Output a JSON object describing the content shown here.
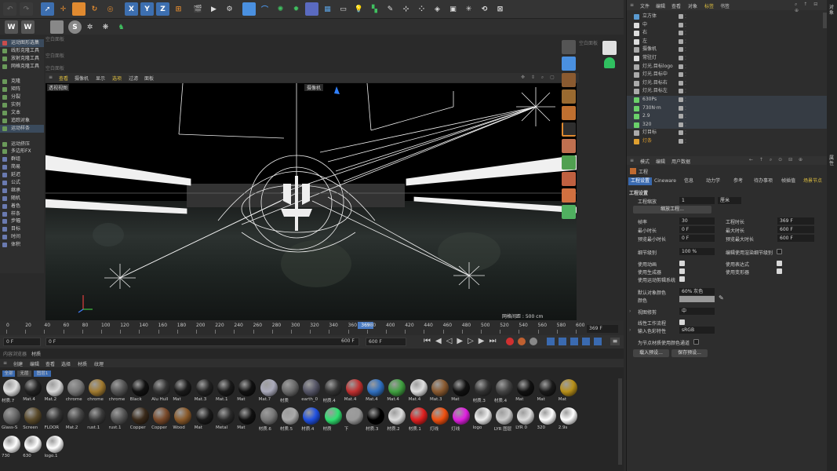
{
  "toolbar": {
    "axis_x": "X",
    "axis_y": "Y",
    "axis_z": "Z"
  },
  "left_panel": {
    "items": [
      {
        "label": "运动图形选集",
        "hl": true,
        "color": "#c84d4d"
      },
      {
        "label": "线形克隆工具",
        "hl": false,
        "color": "#6a9a5a"
      },
      {
        "label": "放射克隆工具",
        "hl": false,
        "color": "#6a9a5a"
      },
      {
        "label": "网格克隆工具",
        "hl": false,
        "color": "#6a9a5a"
      },
      {
        "label": "",
        "hl": false,
        "color": "#2e2e2e"
      },
      {
        "label": "克隆",
        "hl": false,
        "color": "#6a9a5a"
      },
      {
        "label": "矩阵",
        "hl": false,
        "color": "#6a9a5a"
      },
      {
        "label": "分裂",
        "hl": false,
        "color": "#6a9a5a"
      },
      {
        "label": "实例",
        "hl": false,
        "color": "#6a9a5a"
      },
      {
        "label": "文本",
        "hl": false,
        "color": "#6a9a5a"
      },
      {
        "label": "追踪对象",
        "hl": false,
        "color": "#6a9a5a"
      },
      {
        "label": "运动样条",
        "hl": true,
        "color": "#6a9a5a"
      },
      {
        "label": "",
        "hl": false,
        "color": "#2e2e2e"
      },
      {
        "label": "运动挤压",
        "hl": false,
        "color": "#6a9a5a"
      },
      {
        "label": "多边形FX",
        "hl": false,
        "color": "#6a9a5a"
      },
      {
        "label": "群组",
        "hl": false,
        "color": "#6a7ab0"
      },
      {
        "label": "简易",
        "hl": false,
        "color": "#6a7ab0"
      },
      {
        "label": "延迟",
        "hl": false,
        "color": "#6a7ab0"
      },
      {
        "label": "公式",
        "hl": false,
        "color": "#6a7ab0"
      },
      {
        "label": "继承",
        "hl": false,
        "color": "#6a7ab0"
      },
      {
        "label": "随机",
        "hl": false,
        "color": "#6a7ab0"
      },
      {
        "label": "着色",
        "hl": false,
        "color": "#6a7ab0"
      },
      {
        "label": "样条",
        "hl": false,
        "color": "#6a7ab0"
      },
      {
        "label": "步幅",
        "hl": false,
        "color": "#6a7ab0"
      },
      {
        "label": "目标",
        "hl": false,
        "color": "#6a7ab0"
      },
      {
        "label": "时间",
        "hl": false,
        "color": "#6a7ab0"
      },
      {
        "label": "体积",
        "hl": false,
        "color": "#6a7ab0"
      }
    ],
    "empty_panels": [
      "空白面板",
      "空白面板",
      "空白面板"
    ]
  },
  "viewport": {
    "menu": [
      "查看",
      "摄像机",
      "显示",
      "选项",
      "过滤",
      "面板"
    ],
    "label": "透视视图",
    "camera_label": "摄像机",
    "grid_label": "网格间距 : 500 cm",
    "right_empty_panel": "空白面板"
  },
  "timeline": {
    "ticks": [
      "0",
      "20",
      "40",
      "60",
      "80",
      "100",
      "120",
      "140",
      "160",
      "180",
      "200",
      "220",
      "240",
      "260",
      "280",
      "300",
      "320",
      "340",
      "360",
      "380",
      "400",
      "420",
      "440",
      "460",
      "480",
      "500",
      "520",
      "540",
      "560",
      "580",
      "600"
    ],
    "current_frame": "369",
    "end_display": "369 F"
  },
  "playback": {
    "start_field": "0 F",
    "min_field": "0 F",
    "max_field": "600 F",
    "end_field": "600 F"
  },
  "materials": {
    "panel_title": "内容浏览器",
    "panel_tab": "材质",
    "menu": [
      "创建",
      "编辑",
      "查看",
      "选择",
      "材质",
      "纹理"
    ],
    "filters": [
      "全部",
      "无层",
      "图层1"
    ],
    "items": [
      {
        "name": "材质.7",
        "color": "#e0e0e0"
      },
      {
        "name": "Mat.4",
        "color": "#222"
      },
      {
        "name": "Mat.2",
        "color": "#d8d8d8"
      },
      {
        "name": "chrome",
        "color": "#777"
      },
      {
        "name": "chrome",
        "color": "#a07a30"
      },
      {
        "name": "chrome",
        "color": "#555"
      },
      {
        "name": "Black",
        "color": "#111"
      },
      {
        "name": "Alu Hull",
        "color": "#333"
      },
      {
        "name": "Mat",
        "color": "#1a1a1a"
      },
      {
        "name": "Mat.3",
        "color": "#222"
      },
      {
        "name": "Mat.1",
        "color": "#1a1a1a"
      },
      {
        "name": "Mat",
        "color": "#111"
      },
      {
        "name": "Mat.7",
        "color": "#aab"
      },
      {
        "name": "材质",
        "color": "#6a6a6a"
      },
      {
        "name": "earth_0",
        "color": "#556"
      },
      {
        "name": "材质.4",
        "color": "#333"
      },
      {
        "name": "Mat.4",
        "color": "#c03030"
      },
      {
        "name": "Mat.4",
        "color": "#3070c0"
      },
      {
        "name": "Mat.4",
        "color": "#40a040"
      },
      {
        "name": "Mat.4",
        "color": "#e0e0e0"
      },
      {
        "name": "Mat.3",
        "color": "#8a5a30"
      },
      {
        "name": "Mat",
        "color": "#111"
      },
      {
        "name": "材质.3",
        "color": "#333"
      },
      {
        "name": "材质.4",
        "color": "#444"
      },
      {
        "name": "Mat",
        "color": "#111"
      },
      {
        "name": "Mat",
        "color": "#1a1a1a"
      },
      {
        "name": "Mat",
        "color": "#b8901a"
      },
      {
        "name": "Glass-S",
        "color": "#666"
      },
      {
        "name": "Screen",
        "color": "#5a4a2a"
      },
      {
        "name": "FLOOR",
        "color": "#333"
      },
      {
        "name": "Mat.2",
        "color": "#444"
      },
      {
        "name": "rust.1",
        "color": "#3a3a3a"
      },
      {
        "name": "rust.1",
        "color": "#555"
      },
      {
        "name": "Copper",
        "color": "#3a2a1a"
      },
      {
        "name": "Copper",
        "color": "#7a4a2a"
      },
      {
        "name": "Wood",
        "color": "#8a5a2a"
      },
      {
        "name": "Mat",
        "color": "#1a1a1a"
      },
      {
        "name": "Metal",
        "color": "#2a2a2a"
      },
      {
        "name": "Mat",
        "color": "#111"
      },
      {
        "name": "材质.6",
        "color": "#777"
      },
      {
        "name": "材质.5",
        "color": "#aaa"
      },
      {
        "name": "材质.4",
        "color": "#2050e0"
      },
      {
        "name": "材质",
        "color": "#30e070"
      },
      {
        "name": "下",
        "color": "#999"
      },
      {
        "name": "材质.3",
        "color": "#000"
      },
      {
        "name": "材质.2",
        "color": "#ddd"
      },
      {
        "name": "材质.1",
        "color": "#e02020"
      },
      {
        "name": "灯线",
        "color": "#f05010"
      },
      {
        "name": "灯线",
        "color": "#e020e0"
      },
      {
        "name": "logo",
        "color": "#eee"
      },
      {
        "name": "LYR 图层",
        "color": "#ccc"
      },
      {
        "name": "LYR 0",
        "color": "#ddd"
      },
      {
        "name": "320",
        "color": "#fff"
      },
      {
        "name": "2.9s",
        "color": "#fff"
      },
      {
        "name": "730",
        "color": "#fff"
      },
      {
        "name": "630",
        "color": "#fff"
      },
      {
        "name": "logo.1",
        "color": "#fff"
      }
    ]
  },
  "object_manager": {
    "menu": [
      "文件",
      "编辑",
      "查看",
      "对象",
      "标签",
      "书签"
    ],
    "rows": [
      {
        "name": "立方体",
        "color": "#5a9ad0",
        "sel": false
      },
      {
        "name": "中",
        "color": "#ddd",
        "sel": false
      },
      {
        "name": "右",
        "color": "#ddd",
        "sel": false
      },
      {
        "name": "左",
        "color": "#ddd",
        "sel": false
      },
      {
        "name": "摄像机",
        "color": "#aaa",
        "sel": false
      },
      {
        "name": "常驻灯",
        "color": "#ddd",
        "sel": false
      },
      {
        "name": "灯光.目标logo",
        "color": "#aaa",
        "sel": false
      },
      {
        "name": "灯光.目标中",
        "color": "#aaa",
        "sel": false
      },
      {
        "name": "灯光.目标右",
        "color": "#aaa",
        "sel": false
      },
      {
        "name": "灯光.目标左",
        "color": "#aaa",
        "sel": false
      },
      {
        "name": "630Ps",
        "color": "#6ad06a",
        "sel": true
      },
      {
        "name": "730N·m",
        "color": "#6ad06a",
        "sel": true
      },
      {
        "name": "2.9",
        "color": "#6ad06a",
        "sel": true
      },
      {
        "name": "320",
        "color": "#6ad06a",
        "sel": true
      },
      {
        "name": "灯目标",
        "color": "#aaa",
        "sel": false
      },
      {
        "name": "灯条",
        "color": "#e0a030",
        "sel": false
      }
    ]
  },
  "attributes": {
    "menu": [
      "模式",
      "编辑",
      "用户数据"
    ],
    "object_title": "工程",
    "tabs": [
      "工程设置",
      "Cineware",
      "信息",
      "动力学",
      "参考",
      "待办事项",
      "帧插值",
      "场景节点"
    ],
    "section": "工程设置",
    "scale_label": "工程缩放",
    "scale_value": "1",
    "scale_unit": "厘米",
    "scale_button": "缩放工程...",
    "fps_label": "帧率",
    "fps_value": "30",
    "duration_label": "工程时长",
    "duration_value": "369 F",
    "min_label": "最小时长",
    "min_value": "0 F",
    "max_label": "最大时长",
    "max_value": "600 F",
    "pmin_label": "预览最小时长",
    "pmin_value": "0 F",
    "pmax_label": "预览最大时长",
    "pmax_value": "600 F",
    "lod_label": "细节级别",
    "lod_value": "100 %",
    "lod_render_label": "编辑使用渲染细节级别",
    "use_anim": "使用动画",
    "use_expr": "使用表达式",
    "use_gen": "使用生成器",
    "use_deform": "使用变形器",
    "use_motion": "使用运动剪辑系统",
    "default_color_label": "默认对象颜色",
    "default_color_value": "60% 灰色",
    "color_label": "颜色",
    "view_clip_label": "视图修剪",
    "view_clip_value": "中",
    "linear_label": "线性工作流程",
    "input_color_label": "输入色彩特性",
    "input_color_value": "sRGB",
    "node_mat_label": "为节点材质使用颜色通道",
    "load_preset": "载入预设...",
    "save_preset": "保存预设..."
  },
  "side_strip": {
    "labels": [
      "对象",
      "属性"
    ]
  }
}
